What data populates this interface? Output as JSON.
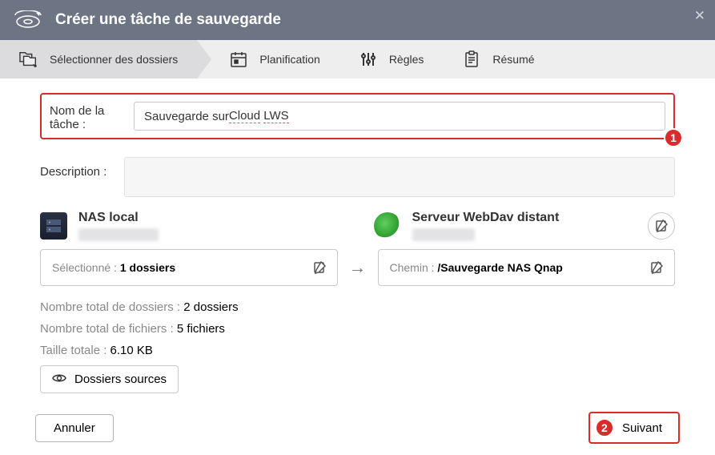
{
  "header": {
    "title": "Créer une tâche de sauvegarde"
  },
  "tabs": {
    "select": "Sélectionner des dossiers",
    "schedule": "Planification",
    "rules": "Règles",
    "summary": "Résumé"
  },
  "form": {
    "name_label": "Nom de la tâche :",
    "name_prefix": "Sauvegarde sur ",
    "name_cloud": "Cloud",
    "name_lws": "LWS",
    "desc_label": "Description :",
    "desc_value": ""
  },
  "source": {
    "name": "NAS local"
  },
  "dest": {
    "name": "Serveur WebDav distant"
  },
  "selected": {
    "label": "Sélectionné : ",
    "value": "1 dossiers"
  },
  "path": {
    "label": "Chemin : ",
    "value": "/Sauvegarde NAS Qnap"
  },
  "stats": {
    "folders_label": "Nombre total de dossiers : ",
    "folders_value": "2 dossiers",
    "files_label": "Nombre total de fichiers : ",
    "files_value": "5 fichiers",
    "size_label": "Taille totale : ",
    "size_value": "6.10 KB"
  },
  "buttons": {
    "sources": "Dossiers sources",
    "cancel": "Annuler",
    "next": "Suivant"
  },
  "badges": {
    "one": "1",
    "two": "2"
  }
}
